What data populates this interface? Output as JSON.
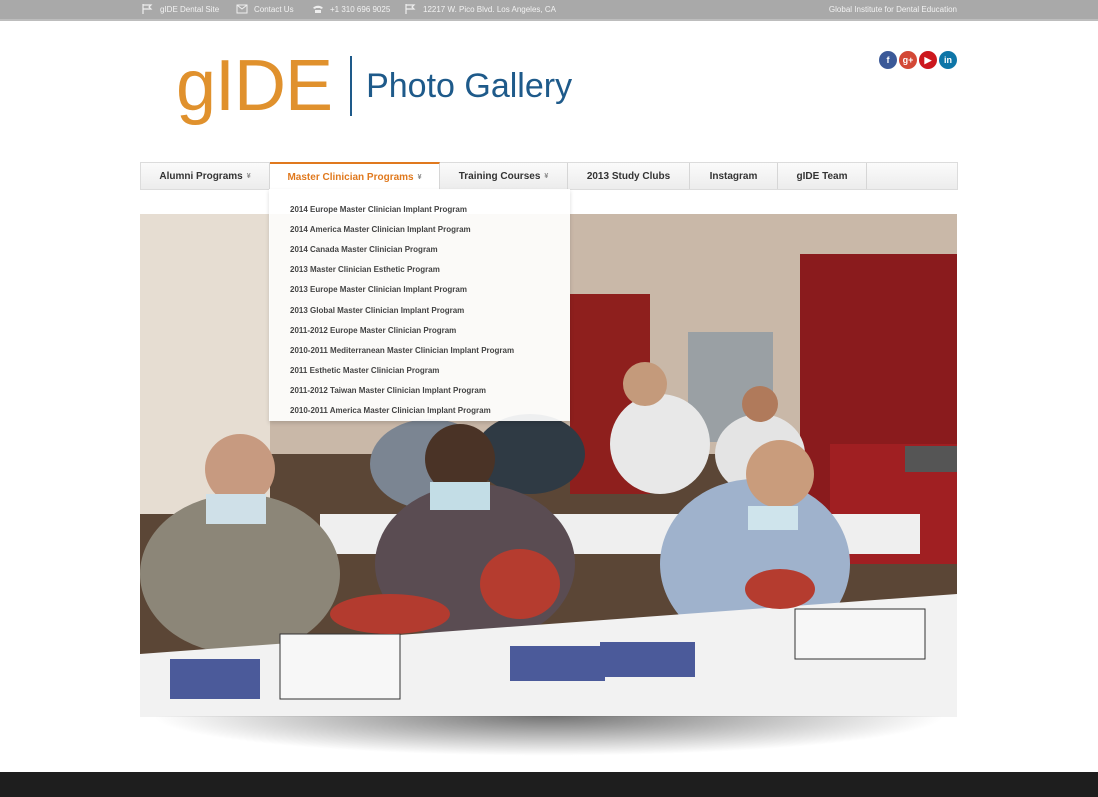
{
  "topbar": {
    "site": "gIDE Dental Site",
    "contact": "Contact Us",
    "phone": "+1 310 696 9025",
    "address": "12217 W. Pico Blvd. Los Angeles, CA",
    "right": "Global Institute for Dental Education"
  },
  "logo": {
    "brand": "gIDE",
    "title": "Photo Gallery"
  },
  "social": [
    {
      "icon": "facebook-icon",
      "glyph": "f",
      "color": "#3b5998"
    },
    {
      "icon": "google-plus-icon",
      "glyph": "g+",
      "color": "#d34836"
    },
    {
      "icon": "youtube-icon",
      "glyph": "▶",
      "color": "#cc181e"
    },
    {
      "icon": "linkedin-icon",
      "glyph": "in",
      "color": "#0e76a8"
    }
  ],
  "nav": {
    "alumni": "Alumni Programs",
    "master": "Master Clinician Programs",
    "training": "Training Courses",
    "study": "2013 Study Clubs",
    "instagram": "Instagram",
    "team": "gIDE Team",
    "caret": "¥"
  },
  "dropdown": {
    "items": [
      "2014 Europe Master Clinician Implant Program",
      "2014 America Master Clinician Implant Program",
      "2014 Canada Master Clinician Program",
      "2013 Master Clinician Esthetic Program",
      "2013 Europe Master Clinician Implant Program",
      "2013 Global Master Clinician Implant Program",
      "2011-2012 Europe Master Clinician Program",
      "2010-2011 Mediterranean Master Clinician Implant Program",
      "2011 Esthetic Master Clinician Program",
      "2011-2012 Taiwan Master Clinician Implant Program",
      "2010-2011 America Master Clinician Implant Program"
    ]
  }
}
